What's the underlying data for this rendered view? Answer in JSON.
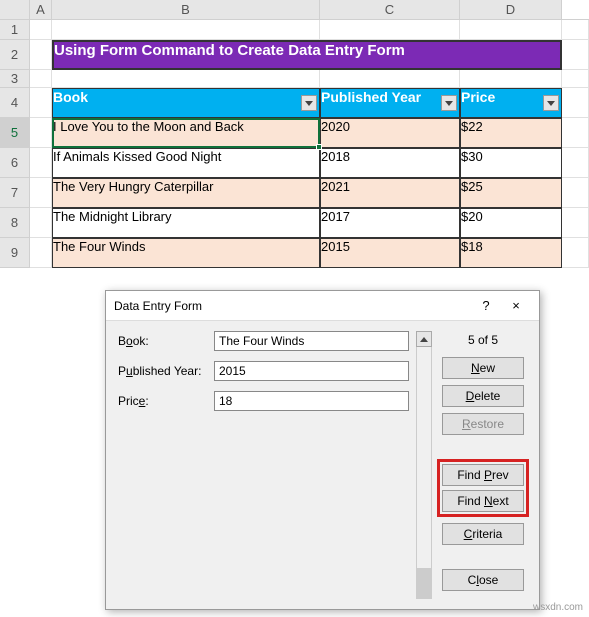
{
  "columns": [
    "A",
    "B",
    "C",
    "D"
  ],
  "rows": [
    "1",
    "2",
    "3",
    "4",
    "5",
    "6",
    "7",
    "8",
    "9"
  ],
  "title": "Using Form Command to Create Data Entry Form",
  "table": {
    "headers": [
      "Book",
      "Published Year",
      "Price"
    ],
    "rows": [
      {
        "book": "I Love You to the Moon and Back",
        "year": "2020",
        "price": "$22"
      },
      {
        "book": "If Animals Kissed Good Night",
        "year": "2018",
        "price": "$30"
      },
      {
        "book": "The Very Hungry Caterpillar",
        "year": "2021",
        "price": "$25"
      },
      {
        "book": "The Midnight Library",
        "year": "2017",
        "price": "$20"
      },
      {
        "book": "The Four Winds",
        "year": "2015",
        "price": "$18"
      }
    ]
  },
  "selected_row": "5",
  "dialog": {
    "title": "Data Entry Form",
    "help": "?",
    "close": "×",
    "fields": {
      "book_label_pre": "B",
      "book_label_u": "o",
      "book_label_post": "ok:",
      "book_value": "The Four Winds",
      "year_label_pre": "P",
      "year_label_u": "u",
      "year_label_post": "blished Year:",
      "year_value": "2015",
      "price_label_pre": "Pric",
      "price_label_u": "e",
      "price_label_post": ":",
      "price_value": "18"
    },
    "counter": "5 of 5",
    "buttons": {
      "new_u": "N",
      "new_post": "ew",
      "delete_u": "D",
      "delete_post": "elete",
      "restore_u": "R",
      "restore_post": "estore",
      "findprev_pre": "Find ",
      "findprev_u": "P",
      "findprev_post": "rev",
      "findnext_pre": "Find ",
      "findnext_u": "N",
      "findnext_post": "ext",
      "criteria_u": "C",
      "criteria_post": "riteria",
      "close_pre": "C",
      "close_u": "l",
      "close_post": "ose"
    }
  },
  "watermark": "wsxdn.com"
}
